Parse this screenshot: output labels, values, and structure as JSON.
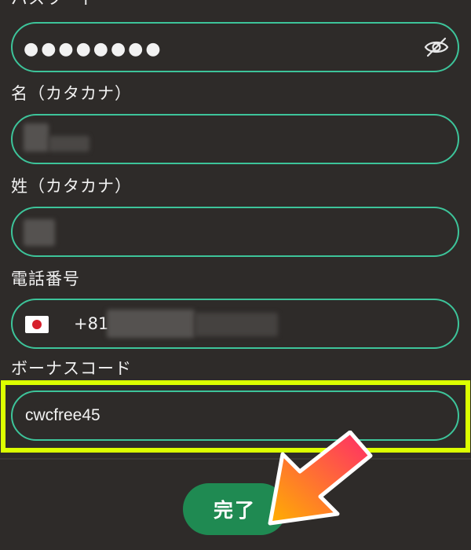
{
  "form": {
    "password": {
      "label": "パスワード",
      "masked_value": "●●●●●●●●",
      "toggle_icon": "eye-slash-icon"
    },
    "first_name_kana": {
      "label": "名（カタカナ）"
    },
    "last_name_kana": {
      "label": "姓（カタカナ）"
    },
    "phone": {
      "label": "電話番号",
      "country_icon": "japan-flag-icon",
      "prefix": "+81"
    },
    "bonus_code": {
      "label": "ボーナスコード",
      "value": "cwcfree45"
    },
    "submit_label": "完了"
  },
  "colors": {
    "background": "#2e2b29",
    "field_border": "#3dc49a",
    "highlight": "#dcff00",
    "button": "#1f8a52",
    "arrow_start": "#ffb000",
    "arrow_end": "#ff2a6a"
  }
}
